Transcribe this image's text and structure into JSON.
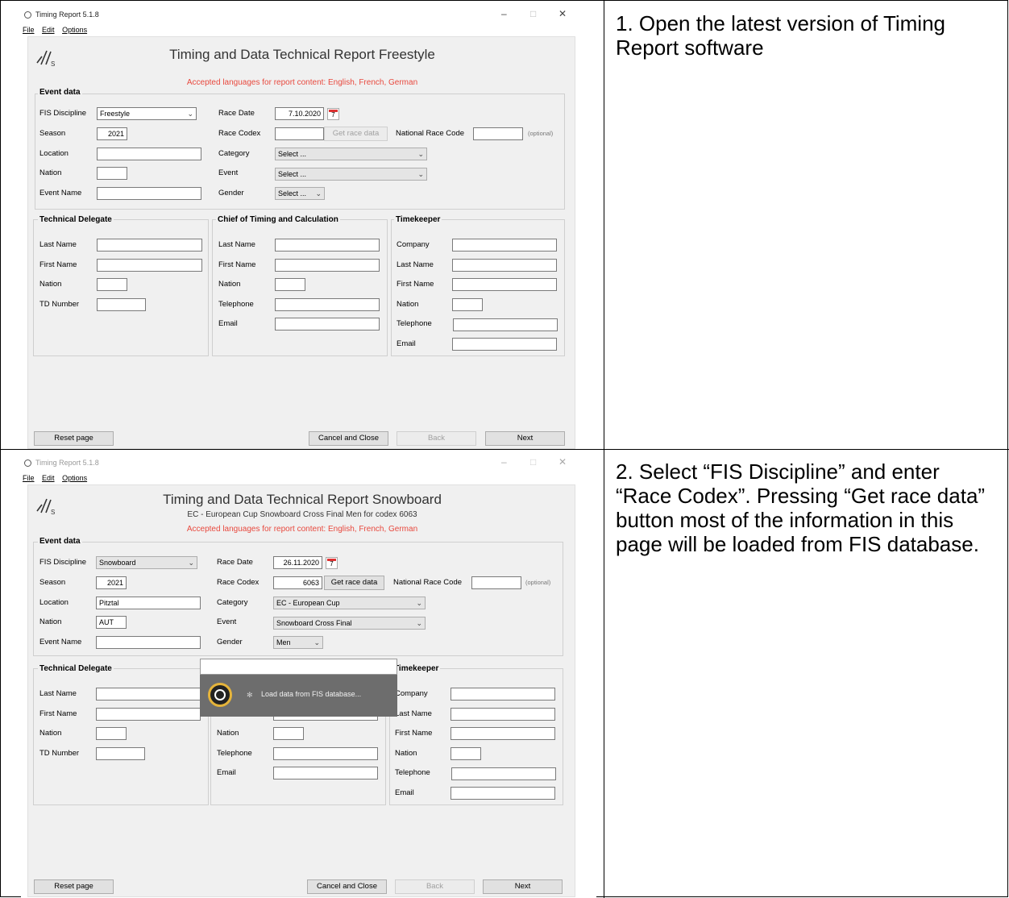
{
  "instructions": [
    "1. Open the latest version of Timing Report software",
    "2. Select “FIS Discipline” and enter “Race Codex”. Pressing “Get race data” button most of the information in this page will be loaded from FIS database."
  ],
  "window": {
    "title": "Timing Report 5.1.8",
    "menu": [
      "File",
      "Edit",
      "Options"
    ],
    "controls": [
      "–",
      "□",
      "✕"
    ]
  },
  "labels": {
    "accepted_languages": "Accepted languages for report content: English, French, German",
    "event_data": "Event data",
    "fis_discipline": "FIS Discipline",
    "season": "Season",
    "location": "Location",
    "nation": "Nation",
    "event_name": "Event Name",
    "race_date": "Race Date",
    "race_codex": "Race Codex",
    "get_race_data": "Get race data",
    "national_race_code": "National Race Code",
    "optional": "(optional)",
    "category": "Category",
    "event": "Event",
    "gender": "Gender",
    "technical_delegate": "Technical Delegate",
    "chief_timing": "Chief of Timing and Calculation",
    "timekeeper": "Timekeeper",
    "last_name": "Last Name",
    "first_name": "First Name",
    "td_number": "TD Number",
    "telephone": "Telephone",
    "email": "Email",
    "company": "Company",
    "reset_page": "Reset page",
    "cancel_close": "Cancel and Close",
    "back": "Back",
    "next": "Next",
    "calendar_day": "7"
  },
  "screens": [
    {
      "report_title": "Timing and Data Technical Report Freestyle",
      "subtitle": "",
      "discipline": "Freestyle",
      "season": "2021",
      "location": "",
      "nation": "",
      "race_date": "7.10.2020",
      "race_codex": "",
      "category": "Select ...",
      "event": "Select ...",
      "gender": "Select ...",
      "loading": ""
    },
    {
      "report_title": "Timing and Data Technical Report Snowboard",
      "subtitle": "EC - European Cup Snowboard Cross Final Men for codex 6063",
      "discipline": "Snowboard",
      "season": "2021",
      "location": "Pitztal",
      "nation": "AUT",
      "race_date": "26.11.2020",
      "race_codex": "6063",
      "category": "EC - European Cup",
      "event": "Snowboard Cross Final",
      "gender": "Men",
      "loading": "Load data from FIS database..."
    }
  ]
}
